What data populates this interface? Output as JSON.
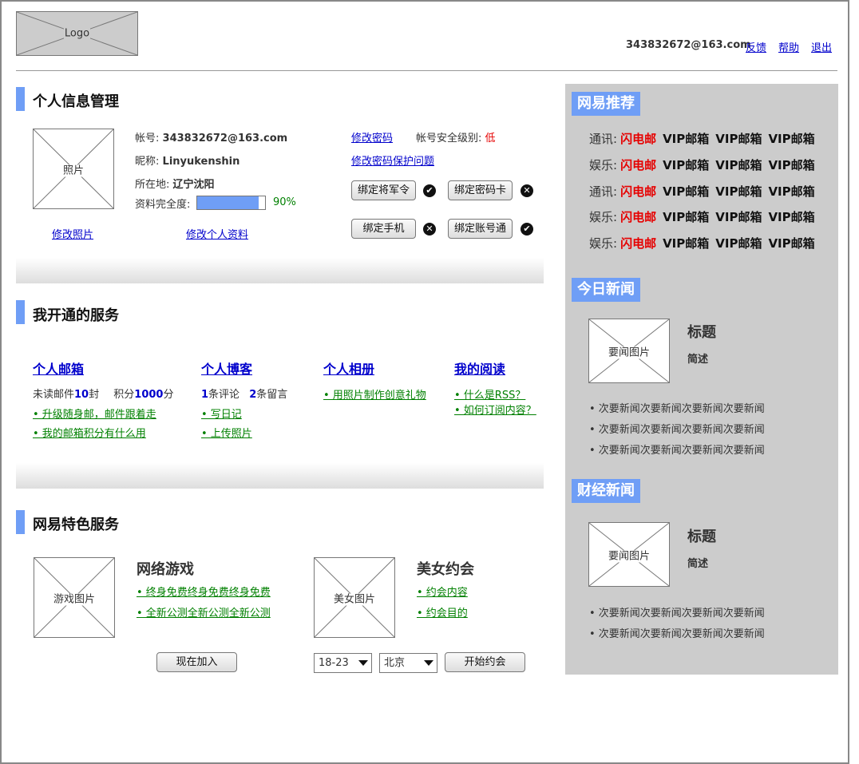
{
  "header": {
    "logo": "Logo",
    "email": "343832672@163.com",
    "links": [
      "反馈",
      "帮助",
      "退出"
    ]
  },
  "profile": {
    "section_title": "个人信息管理",
    "photo_label": "照片",
    "account_label": "帐号:",
    "account_value": "343832672@163.com",
    "nickname_label": "昵称:",
    "nickname_value": "Linyukenshin",
    "location_label": "所在地:",
    "location_value": "辽宁沈阳",
    "completeness_label": "资料完全度:",
    "completeness_value": "90%",
    "completeness_fraction": 0.9,
    "change_password": "修改密码",
    "security_label": "帐号安全级别:",
    "security_value": "低",
    "change_security_question": "修改密码保护问题",
    "bind_buttons": [
      {
        "label": "绑定将军令",
        "status": "check"
      },
      {
        "label": "绑定密码卡",
        "status": "cross"
      },
      {
        "label": "绑定手机",
        "status": "cross"
      },
      {
        "label": "绑定账号通",
        "status": "check"
      }
    ],
    "edit_photo": "修改照片",
    "edit_profile": "修改个人资料"
  },
  "services": {
    "section_title": "我开通的服务",
    "mail": {
      "title": "个人邮箱",
      "unread_prefix": "未读邮件",
      "unread_count": "10",
      "unread_suffix": "封",
      "points_prefix": "积分",
      "points_value": "1000",
      "points_suffix": "分",
      "links": [
        "• 升级随身邮，邮件跟着走",
        "• 我的邮箱积分有什么用"
      ]
    },
    "blog": {
      "title": "个人博客",
      "comments_count": "1",
      "comments_label": "条评论",
      "messages_count": "2",
      "messages_label": "条留言",
      "links": [
        "• 写日记",
        "• 上传照片"
      ]
    },
    "album": {
      "title": "个人相册",
      "links": [
        "• 用照片制作创意礼物"
      ]
    },
    "reading": {
      "title": "我的阅读",
      "links": [
        "• 什么是RSS？",
        "• 如何订阅内容？"
      ]
    }
  },
  "featured": {
    "section_title": "网易特色服务",
    "game": {
      "image_label": "游戏图片",
      "title": "网络游戏",
      "links": [
        "• 终身免费终身免费终身免费",
        "• 全新公测全新公测全新公测"
      ],
      "join_button": "现在加入"
    },
    "dating": {
      "image_label": "美女图片",
      "title": "美女约会",
      "links": [
        "• 约会内容",
        "• 约会目的"
      ],
      "age_select": "18-23",
      "city_select": "北京",
      "start_button": "开始约会"
    }
  },
  "sidebar": {
    "recommend": {
      "title": "网易推荐",
      "rows": [
        {
          "category": "通讯:",
          "highlight": "闪电邮",
          "items": [
            "VIP邮箱",
            "VIP邮箱",
            "VIP邮箱"
          ]
        },
        {
          "category": "娱乐:",
          "highlight": "闪电邮",
          "items": [
            "VIP邮箱",
            "VIP邮箱",
            "VIP邮箱"
          ]
        },
        {
          "category": "通讯:",
          "highlight": "闪电邮",
          "items": [
            "VIP邮箱",
            "VIP邮箱",
            "VIP邮箱"
          ]
        },
        {
          "category": "娱乐:",
          "highlight": "闪电邮",
          "items": [
            "VIP邮箱",
            "VIP邮箱",
            "VIP邮箱"
          ]
        },
        {
          "category": "娱乐:",
          "highlight": "闪电邮",
          "items": [
            "VIP邮箱",
            "VIP邮箱",
            "VIP邮箱"
          ]
        }
      ]
    },
    "today_news": {
      "title": "今日新闻",
      "image_label": "要闻图片",
      "headline": "标题",
      "summary": "简述",
      "items": [
        "• 次要新闻次要新闻次要新闻次要新闻",
        "• 次要新闻次要新闻次要新闻次要新闻",
        "• 次要新闻次要新闻次要新闻次要新闻"
      ]
    },
    "finance_news": {
      "title": "财经新闻",
      "image_label": "要闻图片",
      "headline": "标题",
      "summary": "简述",
      "items": [
        "• 次要新闻次要新闻次要新闻次要新闻",
        "• 次要新闻次要新闻次要新闻次要新闻"
      ]
    }
  },
  "colors": {
    "accent": "#6f9ef6",
    "link": "#0000cc",
    "green_link": "#008000",
    "warning": "#e60000",
    "panel": "#cccccc"
  }
}
